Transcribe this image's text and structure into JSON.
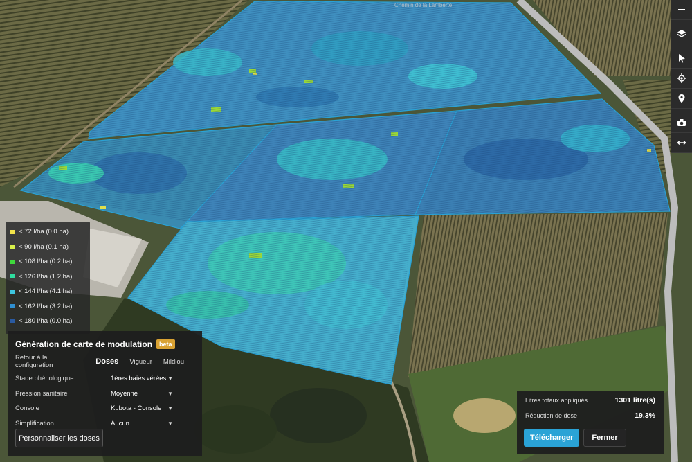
{
  "map": {
    "road_label": "Chemin de la Lamberte"
  },
  "toolbar": {
    "items": [
      {
        "icon": "minus-icon"
      },
      {
        "icon": "layers-icon"
      },
      {
        "icon": "cursor-icon"
      },
      {
        "icon": "locate-icon"
      },
      {
        "icon": "map-pin-icon"
      },
      {
        "icon": "camera-icon"
      },
      {
        "icon": "measure-icon"
      }
    ]
  },
  "legend": {
    "items": [
      {
        "label": "< 72 l/ha (0.0 ha)",
        "color": "#f2e34a"
      },
      {
        "label": "< 90 l/ha (0.1 ha)",
        "color": "#d8f04a"
      },
      {
        "label": "< 108 l/ha (0.2 ha)",
        "color": "#3fd93c"
      },
      {
        "label": "< 126 l/ha (1.2 ha)",
        "color": "#2fdc9e"
      },
      {
        "label": "< 144 l/ha (4.1 ha)",
        "color": "#3ec6df"
      },
      {
        "label": "< 162 l/ha (3.2 ha)",
        "color": "#2f8fd0"
      },
      {
        "label": "< 180 l/ha (0.0 ha)",
        "color": "#2a5aa0"
      }
    ]
  },
  "panel": {
    "title": "Génération de carte de modulation",
    "badge": "beta",
    "tabs": {
      "back": "Retour à la configuration",
      "doses": "Doses",
      "vigueur": "Vigueur",
      "mildiou": "Mildiou"
    },
    "fields": [
      {
        "label": "Stade phénologique",
        "value": "1ères baies vérées"
      },
      {
        "label": "Pression sanitaire",
        "value": "Moyenne"
      },
      {
        "label": "Console",
        "value": "Kubota - Console"
      },
      {
        "label": "Simplification",
        "value": "Aucun"
      }
    ],
    "custom_button": "Personnaliser les doses"
  },
  "summary": {
    "total_label": "Litres totaux appliqués",
    "total_value": "1301 litre(s)",
    "reduction_label": "Réduction de dose",
    "reduction_value": "19.3%",
    "download_button": "Télécharger",
    "close_button": "Fermer"
  },
  "colors": {
    "accent": "#2aa3d6",
    "beta_badge": "#d9a233"
  }
}
